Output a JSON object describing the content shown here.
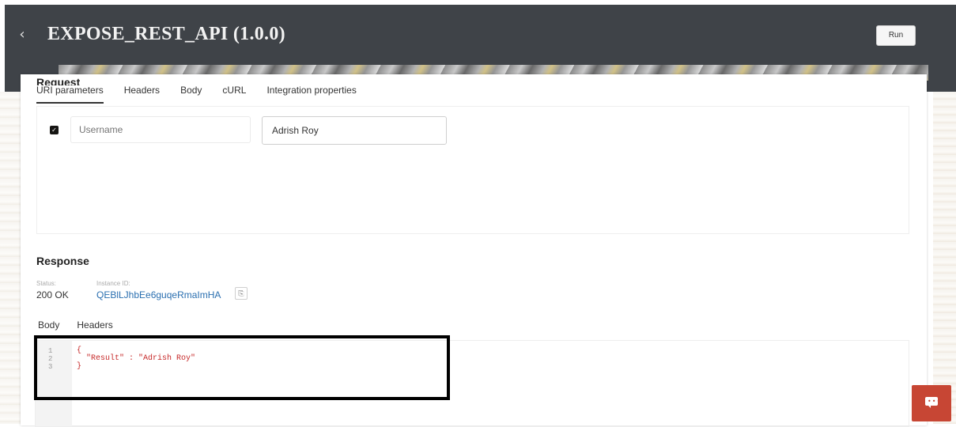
{
  "header": {
    "back_icon": "chevron-left-icon",
    "title": "EXPOSE_REST_API (1.0.0)",
    "run_label": "Run"
  },
  "request": {
    "title": "Request",
    "tabs": [
      {
        "label": "URI parameters",
        "active": true
      },
      {
        "label": "Headers",
        "active": false
      },
      {
        "label": "Body",
        "active": false
      },
      {
        "label": "cURL",
        "active": false
      },
      {
        "label": "Integration properties",
        "active": false
      }
    ],
    "params": {
      "checked": true,
      "name_placeholder": "Username",
      "value": "Adrish Roy"
    }
  },
  "response": {
    "title": "Response",
    "status_label": "Status:",
    "status_value": "200 OK",
    "instance_label": "Instance ID:",
    "instance_value": "QEBlLJhbEe6guqeRmaImHA",
    "tabs": [
      {
        "label": "Body"
      },
      {
        "label": "Headers"
      }
    ],
    "body": {
      "line_numbers": [
        "1",
        "2",
        "3"
      ],
      "lines": [
        "{",
        "  \"Result\" : \"Adrish Roy\"",
        "}"
      ]
    }
  },
  "colors": {
    "header_bg": "#3f4348",
    "link": "#2a6fb0",
    "code_text": "#c62828",
    "chat_button": "#c74634"
  }
}
